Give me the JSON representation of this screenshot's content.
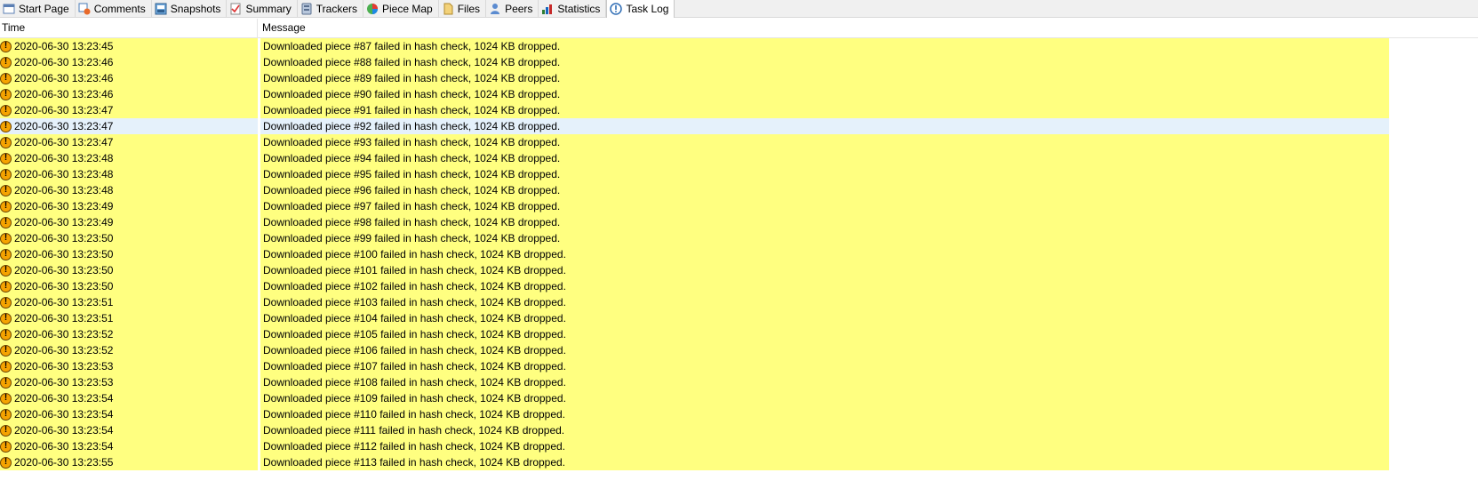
{
  "tabs": [
    {
      "label": "Start Page",
      "icon": "start-page-icon",
      "active": false
    },
    {
      "label": "Comments",
      "icon": "comments-icon",
      "active": false
    },
    {
      "label": "Snapshots",
      "icon": "snapshots-icon",
      "active": false
    },
    {
      "label": "Summary",
      "icon": "summary-icon",
      "active": false
    },
    {
      "label": "Trackers",
      "icon": "trackers-icon",
      "active": false
    },
    {
      "label": "Piece Map",
      "icon": "piece-map-icon",
      "active": false
    },
    {
      "label": "Files",
      "icon": "files-icon",
      "active": false
    },
    {
      "label": "Peers",
      "icon": "peers-icon",
      "active": false
    },
    {
      "label": "Statistics",
      "icon": "statistics-icon",
      "active": false
    },
    {
      "label": "Task Log",
      "icon": "task-log-icon",
      "active": true
    }
  ],
  "columns": {
    "time": "Time",
    "message": "Message"
  },
  "warning_icon_glyph": "!",
  "row_color": "#ffff80",
  "selected_row_color": "#e5f1fb",
  "log": [
    {
      "time": "2020-06-30 13:23:45",
      "message": "Downloaded piece #87 failed in hash check, 1024 KB dropped."
    },
    {
      "time": "2020-06-30 13:23:46",
      "message": "Downloaded piece #88 failed in hash check, 1024 KB dropped."
    },
    {
      "time": "2020-06-30 13:23:46",
      "message": "Downloaded piece #89 failed in hash check, 1024 KB dropped."
    },
    {
      "time": "2020-06-30 13:23:46",
      "message": "Downloaded piece #90 failed in hash check, 1024 KB dropped."
    },
    {
      "time": "2020-06-30 13:23:47",
      "message": "Downloaded piece #91 failed in hash check, 1024 KB dropped."
    },
    {
      "time": "2020-06-30 13:23:47",
      "message": "Downloaded piece #92 failed in hash check, 1024 KB dropped.",
      "selected": true
    },
    {
      "time": "2020-06-30 13:23:47",
      "message": "Downloaded piece #93 failed in hash check, 1024 KB dropped."
    },
    {
      "time": "2020-06-30 13:23:48",
      "message": "Downloaded piece #94 failed in hash check, 1024 KB dropped."
    },
    {
      "time": "2020-06-30 13:23:48",
      "message": "Downloaded piece #95 failed in hash check, 1024 KB dropped."
    },
    {
      "time": "2020-06-30 13:23:48",
      "message": "Downloaded piece #96 failed in hash check, 1024 KB dropped."
    },
    {
      "time": "2020-06-30 13:23:49",
      "message": "Downloaded piece #97 failed in hash check, 1024 KB dropped."
    },
    {
      "time": "2020-06-30 13:23:49",
      "message": "Downloaded piece #98 failed in hash check, 1024 KB dropped."
    },
    {
      "time": "2020-06-30 13:23:50",
      "message": "Downloaded piece #99 failed in hash check, 1024 KB dropped."
    },
    {
      "time": "2020-06-30 13:23:50",
      "message": "Downloaded piece #100 failed in hash check, 1024 KB dropped."
    },
    {
      "time": "2020-06-30 13:23:50",
      "message": "Downloaded piece #101 failed in hash check, 1024 KB dropped."
    },
    {
      "time": "2020-06-30 13:23:50",
      "message": "Downloaded piece #102 failed in hash check, 1024 KB dropped."
    },
    {
      "time": "2020-06-30 13:23:51",
      "message": "Downloaded piece #103 failed in hash check, 1024 KB dropped."
    },
    {
      "time": "2020-06-30 13:23:51",
      "message": "Downloaded piece #104 failed in hash check, 1024 KB dropped."
    },
    {
      "time": "2020-06-30 13:23:52",
      "message": "Downloaded piece #105 failed in hash check, 1024 KB dropped."
    },
    {
      "time": "2020-06-30 13:23:52",
      "message": "Downloaded piece #106 failed in hash check, 1024 KB dropped."
    },
    {
      "time": "2020-06-30 13:23:53",
      "message": "Downloaded piece #107 failed in hash check, 1024 KB dropped."
    },
    {
      "time": "2020-06-30 13:23:53",
      "message": "Downloaded piece #108 failed in hash check, 1024 KB dropped."
    },
    {
      "time": "2020-06-30 13:23:54",
      "message": "Downloaded piece #109 failed in hash check, 1024 KB dropped."
    },
    {
      "time": "2020-06-30 13:23:54",
      "message": "Downloaded piece #110 failed in hash check, 1024 KB dropped."
    },
    {
      "time": "2020-06-30 13:23:54",
      "message": "Downloaded piece #111 failed in hash check, 1024 KB dropped."
    },
    {
      "time": "2020-06-30 13:23:54",
      "message": "Downloaded piece #112 failed in hash check, 1024 KB dropped."
    },
    {
      "time": "2020-06-30 13:23:55",
      "message": "Downloaded piece #113 failed in hash check, 1024 KB dropped."
    }
  ]
}
